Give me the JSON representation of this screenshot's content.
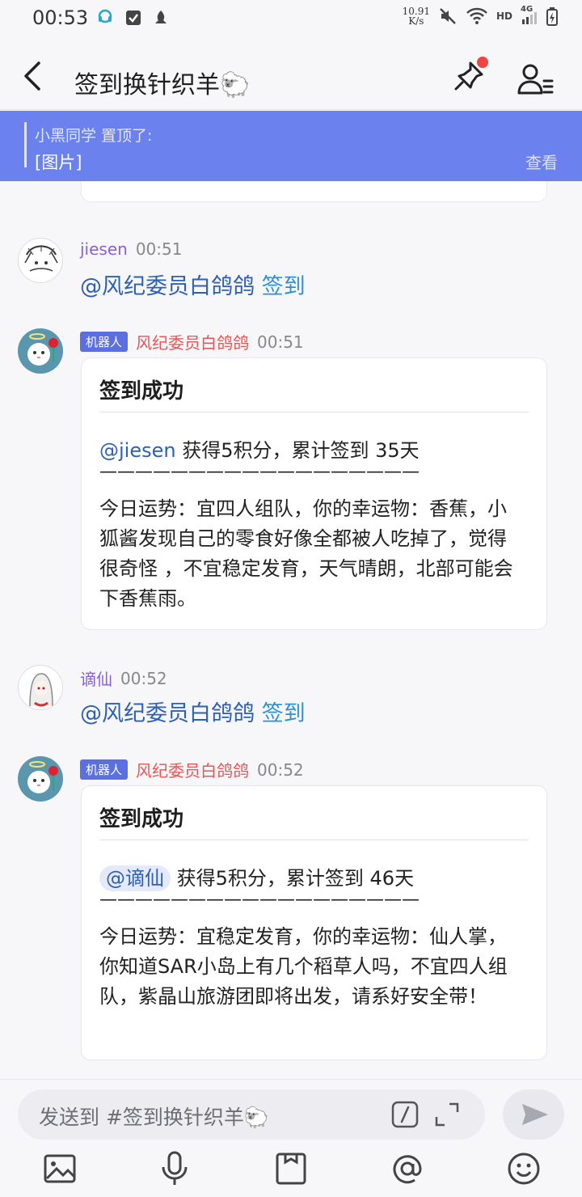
{
  "status_bar": {
    "time": "00:53",
    "speed_top": "10.91",
    "speed_bottom": "K/s",
    "network": "HD",
    "signal": "4G"
  },
  "header": {
    "title": "签到换针织羊🐑"
  },
  "pinned": {
    "author_line": "小黑同学 置顶了:",
    "content": "[图片]",
    "view_label": "查看"
  },
  "messages": [
    {
      "author": "jiesen",
      "time": "00:51",
      "mention": "@风纪委员白鸽鸽",
      "command": "签到"
    },
    {
      "bot_tag": "机器人",
      "author": "风纪委员白鸽鸽",
      "time": "00:51",
      "card_title": "签到成功",
      "card_mention": "@jiesen",
      "card_summary": "获得5积分，累计签到 35天",
      "card_separator": "——————————————————",
      "card_body": "今日运势：宜四人组队，你的幸运物：香蕉，小狐酱发现自己的零食好像全都被人吃掉了，觉得很奇怪 ，不宜稳定发育，天气晴朗，北部可能会下香蕉雨。"
    },
    {
      "author": "谪仙",
      "time": "00:52",
      "mention": "@风纪委员白鸽鸽",
      "command": "签到"
    },
    {
      "bot_tag": "机器人",
      "author": "风纪委员白鸽鸽",
      "time": "00:52",
      "card_title": "签到成功",
      "card_mention": "@谪仙",
      "card_summary": "获得5积分，累计签到 46天",
      "card_separator": "——————————————————",
      "card_body": "今日运势：宜稳定发育，你的幸运物：仙人掌，你知道SAR小岛上有几个稻草人吗，不宜四人组队，紫晶山旅游团即将出发，请系好安全带！"
    }
  ],
  "input": {
    "placeholder": "发送到 #签到换针织羊🐑"
  },
  "colors": {
    "accent": "#6b82ee",
    "bot_tag": "#5b6fe0",
    "bot_name": "#ea5454",
    "user_name": "#8a5fd6",
    "mention": "#2d5fb3",
    "notification_dot": "#f04444"
  },
  "icons": {
    "toolbar": [
      "image-icon",
      "microphone-icon",
      "card-icon",
      "at-icon",
      "emoji-icon"
    ]
  }
}
